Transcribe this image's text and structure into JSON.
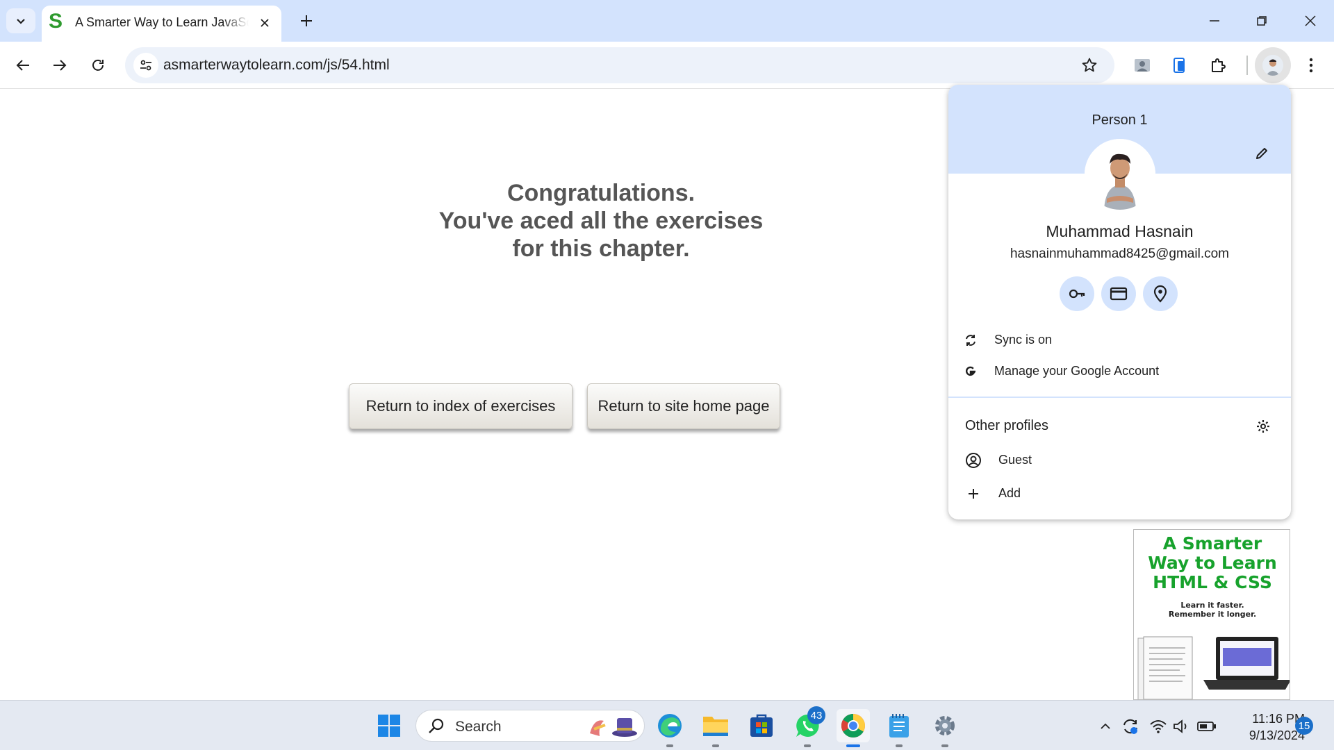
{
  "browser": {
    "tab": {
      "title": "A Smarter Way to Learn JavaScript",
      "favicon_letter": "S"
    },
    "address_bar": {
      "url": "asmarterwaytolearn.com/js/54.html"
    },
    "window_controls": [
      "minimize-icon",
      "restore-icon",
      "close-icon"
    ]
  },
  "page": {
    "congrats_lines": [
      "Congratulations.",
      "You've aced all the exercises",
      "for this chapter."
    ],
    "buttons": {
      "index": "Return to index of exercises",
      "home": "Return to site home page"
    },
    "book_ad": {
      "title_lines": [
        "A Smarter",
        "Way to Learn",
        "HTML & CSS"
      ],
      "subtitle_lines": [
        "Learn it faster.",
        "Remember it longer."
      ]
    }
  },
  "profile_menu": {
    "header": "Person 1",
    "name": "Muhammad Hasnain",
    "email": "hasnainmuhammad8425@gmail.com",
    "quick_icons": [
      "key-icon",
      "credit-card-icon",
      "location-pin-icon"
    ],
    "items": [
      {
        "label": "Sync is on",
        "icon": "sync-icon"
      },
      {
        "label": "Manage your Google Account",
        "icon": "google-g-icon"
      }
    ],
    "other_profiles_title": "Other profiles",
    "profiles": [
      {
        "label": "Guest",
        "icon": "guest-icon"
      },
      {
        "label": "Add",
        "icon": "plus-icon"
      }
    ]
  },
  "taskbar": {
    "search_placeholder": "Search",
    "whatsapp_badge": "43",
    "time": "11:16 PM",
    "date": "9/13/2024",
    "notification_count": "15"
  }
}
